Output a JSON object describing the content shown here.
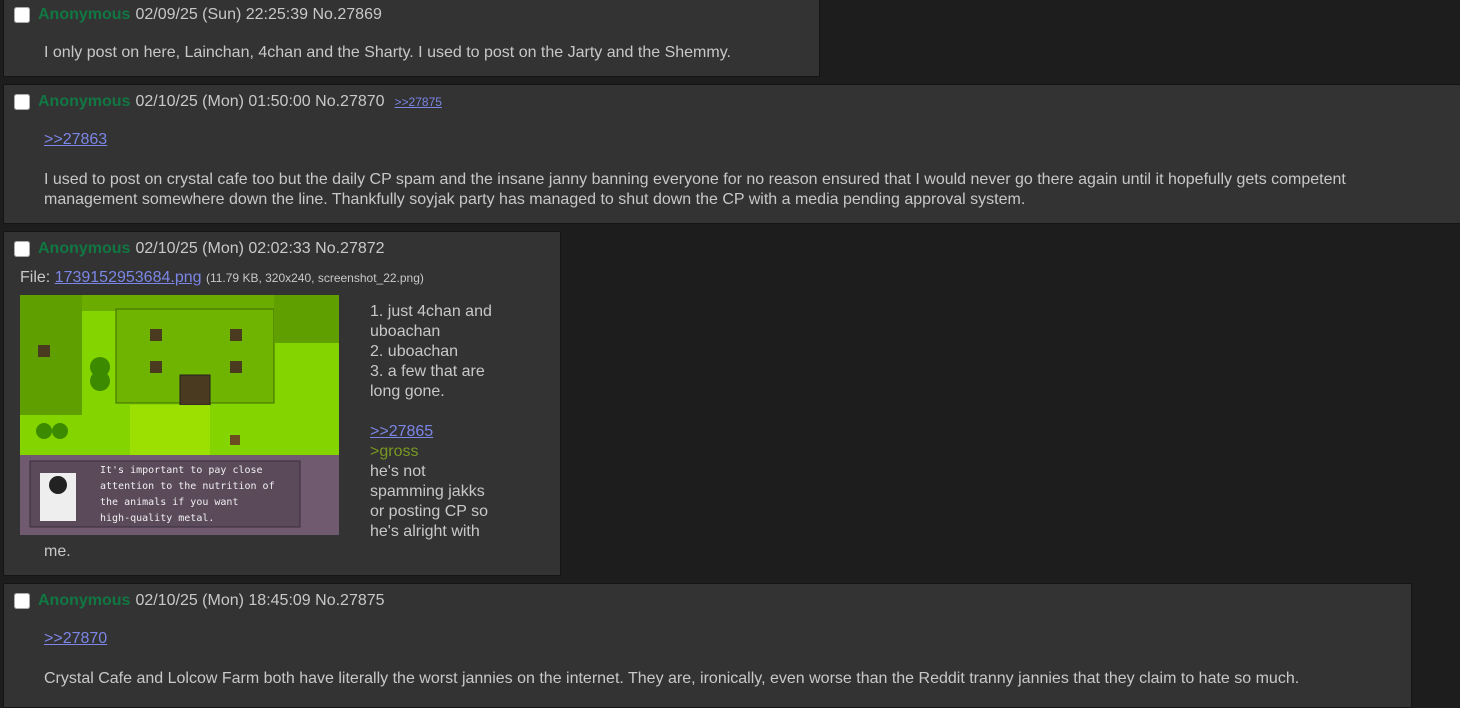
{
  "posts": [
    {
      "name": "Anonymous",
      "datetime": "02/09/25 (Sun) 22:25:39",
      "number": "No.27869",
      "text": "I only post on here, Lainchan, 4chan and the Sharty.  I used to post on the Jarty and the Shemmy."
    },
    {
      "name": "Anonymous",
      "datetime": "02/10/25 (Mon) 01:50:00",
      "number": "No.27870",
      "backlink": ">>27875",
      "quote": ">>27863",
      "text": "I used to post on crystal cafe too but the daily CP spam and the insane janny banning everyone for no reason ensured that I would never go there again until it hopefully gets competent management somewhere down the line.  Thankfully soyjak party has managed to shut down the CP with a media pending approval system."
    },
    {
      "name": "Anonymous",
      "datetime": "02/10/25 (Mon) 02:02:33",
      "number": "No.27872",
      "file_label": "File:",
      "file_name": "1739152953684.png",
      "file_meta": "(11.79 KB, 320x240, screenshot_22.png)",
      "game_dialog": [
        "It's important to pay close",
        "attention to the nutrition of",
        "the animals if you want",
        "high-quality metal."
      ],
      "lines": [
        "1. just 4chan and",
        "uboachan",
        "2. uboachan",
        "3. a few that are",
        "long gone."
      ],
      "quote": ">>27865",
      "greentext": ">gross",
      "reply_lines": [
        "he's not",
        "spamming jakks",
        "or posting CP so",
        "he's alright with"
      ],
      "tail": "me."
    },
    {
      "name": "Anonymous",
      "datetime": "02/10/25 (Mon) 18:45:09",
      "number": "No.27875",
      "quote": ">>27870",
      "text": "Crystal Cafe and Lolcow Farm both have literally the worst jannies on the internet.  They are, ironically, even worse than the Reddit tranny jannies that they claim to hate so much."
    }
  ],
  "colors": {
    "name": "#117743",
    "link": "#7b86e6",
    "greentext": "#789922",
    "post_bg": "#333333",
    "page_bg": "#1d1d1d"
  }
}
